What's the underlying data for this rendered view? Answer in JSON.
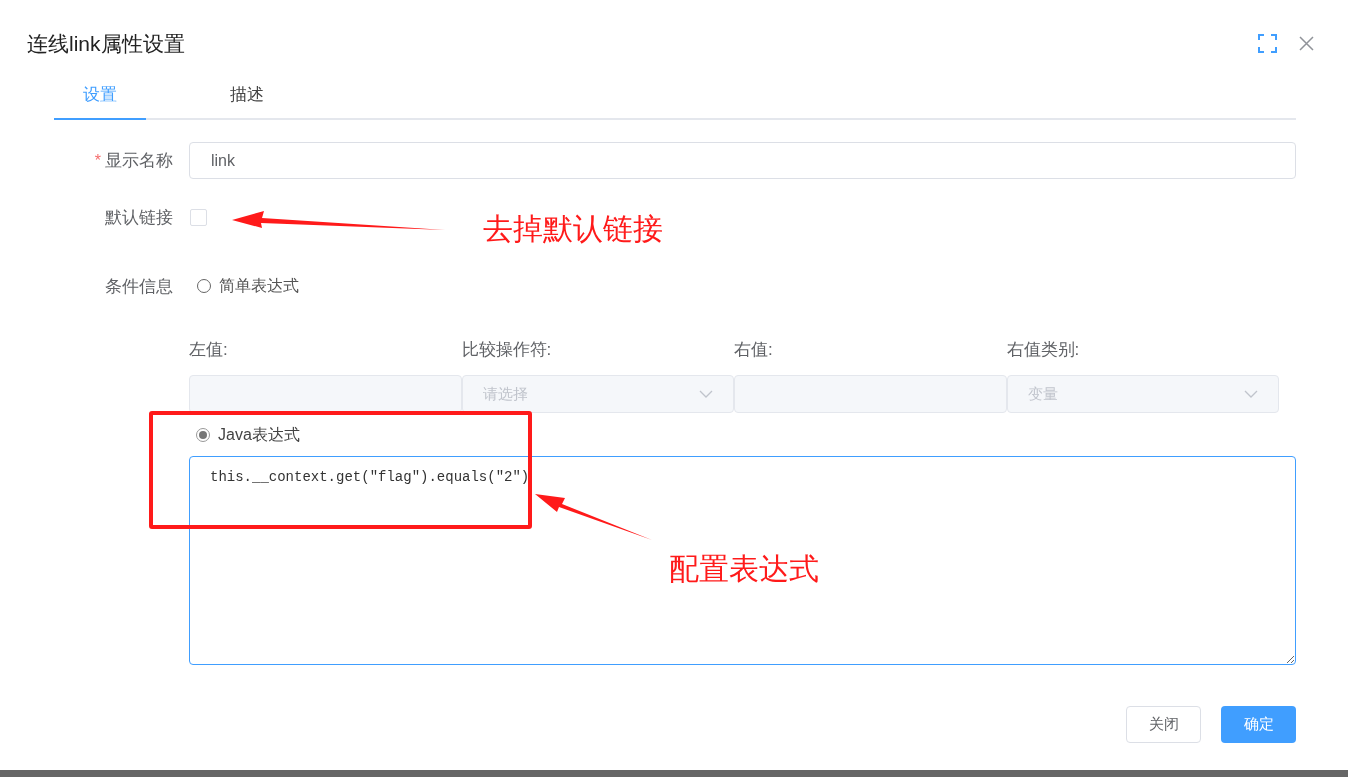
{
  "dialog": {
    "title": "连线link属性设置"
  },
  "tabs": [
    {
      "label": "设置",
      "selected": true
    },
    {
      "label": "描述",
      "selected": false
    }
  ],
  "form": {
    "name": {
      "label": "显示名称",
      "required_mark": "*",
      "value": "link"
    },
    "default_link": {
      "label": "默认链接",
      "checked": false
    },
    "condition": {
      "label": "条件信息",
      "options": [
        {
          "label": "简单表达式",
          "selected": false
        },
        {
          "label": "Java表达式",
          "selected": true
        }
      ],
      "simple": {
        "disabled": true,
        "columns": [
          {
            "label": "左值:",
            "kind": "input"
          },
          {
            "label": "比较操作符:",
            "kind": "select",
            "placeholder": "请选择"
          },
          {
            "label": "右值:",
            "kind": "input"
          },
          {
            "label": "右值类别:",
            "kind": "select",
            "value": "变量"
          }
        ]
      },
      "java_expression": "this.__context.get(\"flag\").equals(\"2\")"
    }
  },
  "buttons": [
    {
      "label": "关闭",
      "kind": "default"
    },
    {
      "label": "确定",
      "kind": "primary"
    }
  ],
  "annotations": [
    {
      "text": "去掉默认链接"
    },
    {
      "text": "配置表达式"
    }
  ]
}
